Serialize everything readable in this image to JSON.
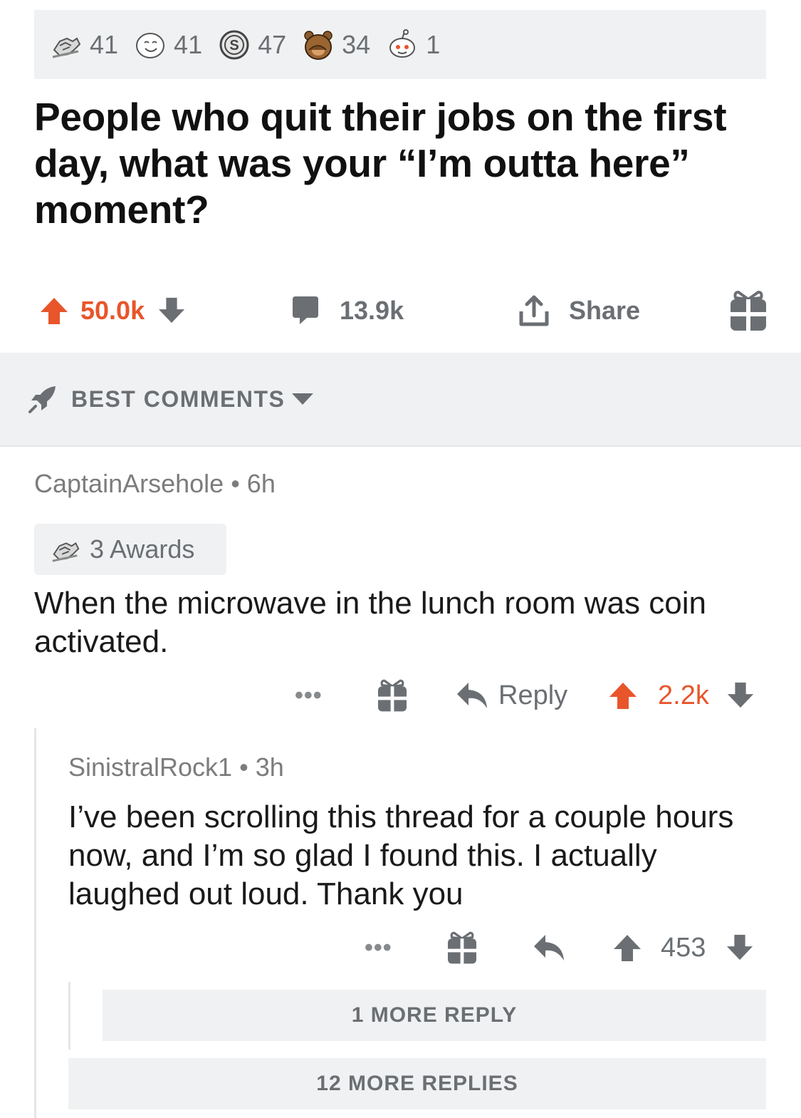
{
  "awards": [
    {
      "icon": "helpful-hands-icon",
      "count": "41"
    },
    {
      "icon": "wholesome-face-icon",
      "count": "41"
    },
    {
      "icon": "silver-coin-icon",
      "count": "47"
    },
    {
      "icon": "facepalm-bear-icon",
      "count": "34"
    },
    {
      "icon": "snoo-face-icon",
      "count": "1"
    }
  ],
  "post": {
    "title": "People who quit their jobs on the first day, what was your “I’m outta here” moment?",
    "score": "50.0k",
    "comments": "13.9k",
    "share_label": "Share"
  },
  "sort": {
    "label": "BEST COMMENTS"
  },
  "comment1": {
    "author": "CaptainArsehole",
    "age": "6h",
    "awards_label": "3 Awards",
    "body": "When the microwave in the lunch room was coin activated.",
    "reply_label": "Reply",
    "score": "2.2k"
  },
  "comment2": {
    "author": "SinistralRock1",
    "age": "3h",
    "body": "I’ve been scrolling this thread for a couple hours now, and I’m so glad I found this. I actually laughed out loud. Thank you",
    "score": "453"
  },
  "more": {
    "nested_label": "1 MORE REPLY",
    "thread_label": "12 MORE REPLIES"
  },
  "colors": {
    "upvote": "#e8552b",
    "muted": "#6b6f73",
    "panel": "#f0f1f2"
  }
}
